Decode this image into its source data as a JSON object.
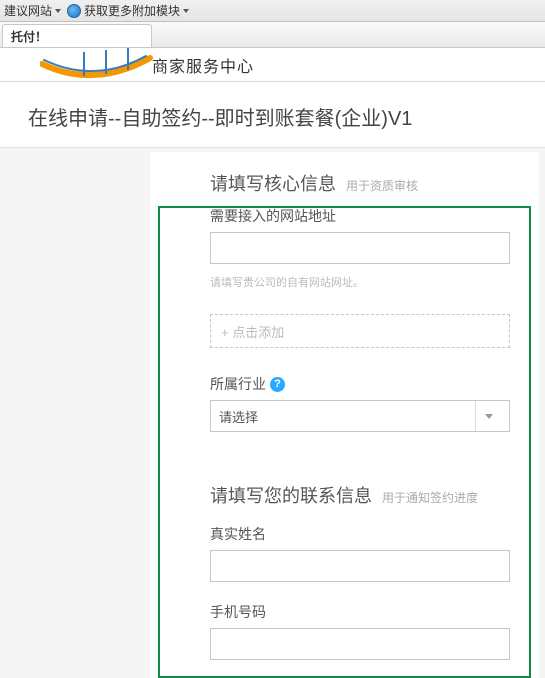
{
  "browser": {
    "bookmarks_label": "建议网站",
    "addons_label": "获取更多附加模块",
    "tab_title": "托付！"
  },
  "header": {
    "merchant_center": "商家服务中心"
  },
  "page": {
    "title": "在线申请--自助签约--即时到账套餐(企业)V1"
  },
  "core": {
    "section_title": "请填写核心信息",
    "section_hint": "用于资质审核",
    "website_label": "需要接入的网站地址",
    "website_value": "",
    "website_hint": "请填写贵公司的自有网站网址。",
    "add_more": "+ 点击添加",
    "industry_label": "所属行业",
    "industry_selected": "请选择"
  },
  "contact": {
    "section_title": "请填写您的联系信息",
    "section_hint": "用于通知签约进度",
    "real_name_label": "真实姓名",
    "real_name_value": "",
    "phone_label": "手机号码",
    "phone_value": ""
  }
}
